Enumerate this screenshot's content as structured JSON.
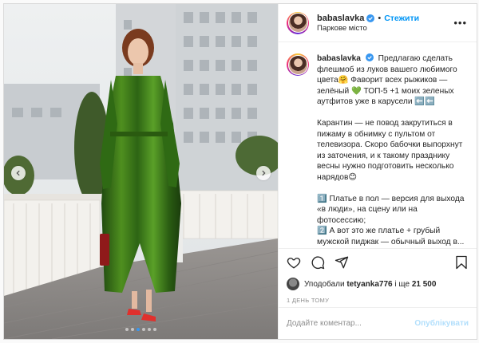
{
  "post": {
    "username": "babaslavka",
    "follow_label": "Стежити",
    "location": "Паркове місто",
    "more_label": "•••"
  },
  "caption": {
    "username": "babaslavka",
    "paragraphs": [
      "Предлагаю сделать флешмоб из луков вашего любимого цвета🤗 Фаворит всех рыжиков — зелёный 💚 ТОП-5 +1 моих зеленых аутфитов уже в карусели ⬅️⬅️",
      "Карантин — не повод закрутиться в пижаму в обнимку с пультом от телевизора. Скоро бабочки выпорхнут из заточения, и к такому празднику весны нужно подготовить несколько нарядов😊",
      "1️⃣ Платье в пол — версия для выхода «в люди», на сцену или на фотосессию;\n2️⃣ А вот это же платье + грубый мужской пиджак — обычный выход в..."
    ]
  },
  "likes": {
    "prefix": "Уподобали",
    "user": "tetyanka776",
    "middle": "і ще",
    "count": "21 500"
  },
  "timestamp": "1 ДЕНЬ ТОМУ",
  "comment": {
    "placeholder": "Додайте коментар...",
    "publish_label": "Опублікувати"
  },
  "carousel": {
    "total_slides": 6,
    "active_slide": 3
  },
  "colors": {
    "link": "#0095f6",
    "publish_disabled": "#b2dffc",
    "active_dot": "#3897f0"
  }
}
